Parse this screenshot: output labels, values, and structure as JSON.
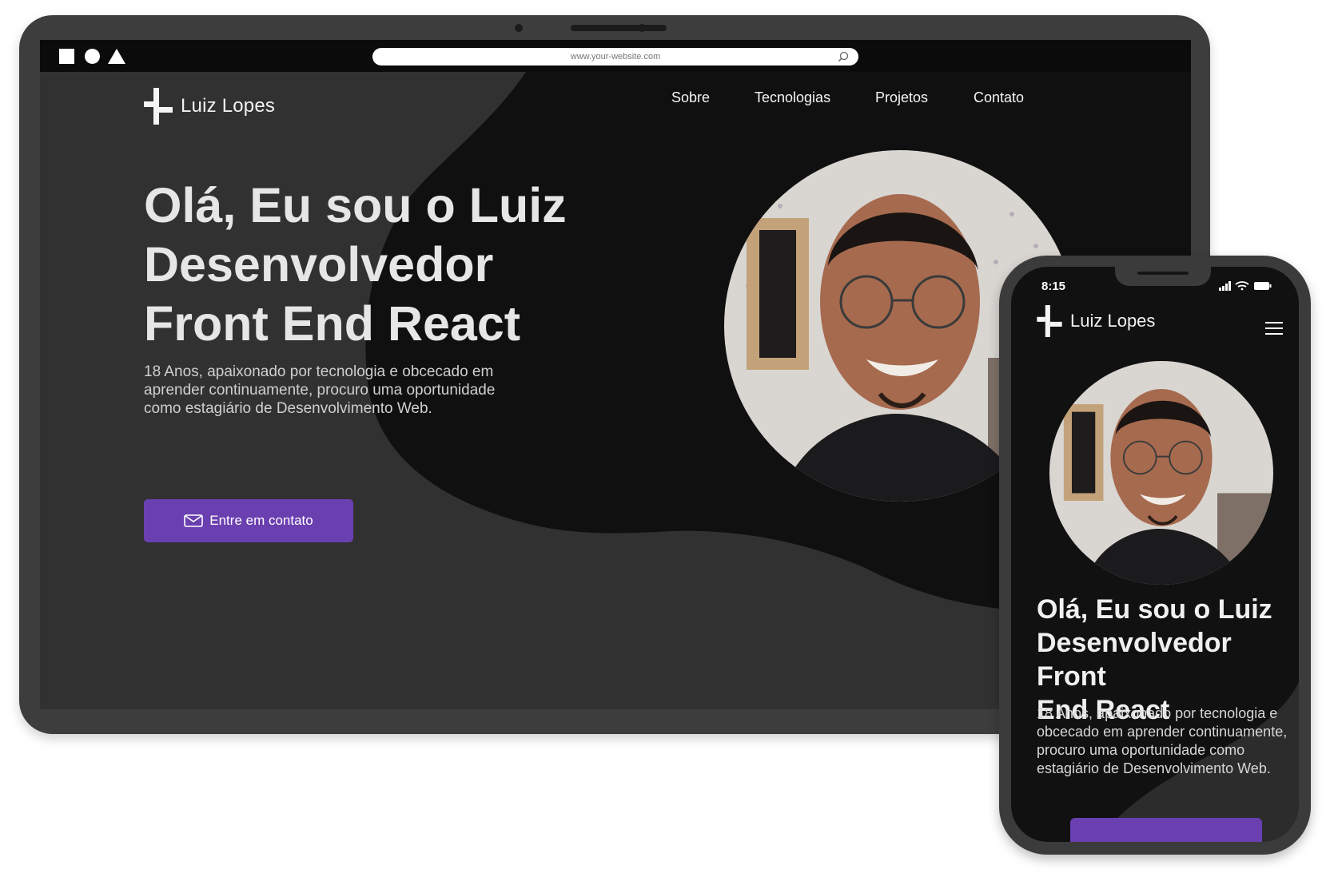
{
  "desktop": {
    "browser": {
      "url": "www.your-website.com"
    },
    "brand": {
      "name": "Luiz Lopes"
    },
    "nav": {
      "items": [
        "Sobre",
        "Tecnologias",
        "Projetos",
        "Contato"
      ]
    },
    "hero": {
      "title_lines": [
        "Olá, Eu sou o Luiz",
        "Desenvolvedor",
        "Front End React"
      ],
      "description": "18 Anos, apaixonado por tecnologia e obcecado em aprender continuamente, procuro uma oportunidade como estagiário de Desenvolvimento Web.",
      "cta_label": "Entre em contato"
    }
  },
  "mobile": {
    "status": {
      "time": "8:15"
    },
    "brand": {
      "name": "Luiz Lopes"
    },
    "hero": {
      "title_lines": [
        "Olá, Eu sou o Luiz",
        "Desenvolvedor Front",
        "End React"
      ],
      "description": "18 Anos, apaixonado por tecnologia e obcecado em aprender continuamente, procuro uma oportunidade como estagiário de Desenvolvimento Web."
    }
  },
  "colors": {
    "accent": "#6a3fb0",
    "background_dark": "#111111",
    "background_gray": "#313131",
    "device_frame": "#3d3d3d"
  },
  "icons": [
    "square-shape-icon",
    "circle-shape-icon",
    "triangle-shape-icon",
    "search-icon",
    "logo-mark-icon",
    "mail-icon",
    "signal-icon",
    "wifi-icon",
    "battery-icon",
    "hamburger-menu-icon"
  ]
}
